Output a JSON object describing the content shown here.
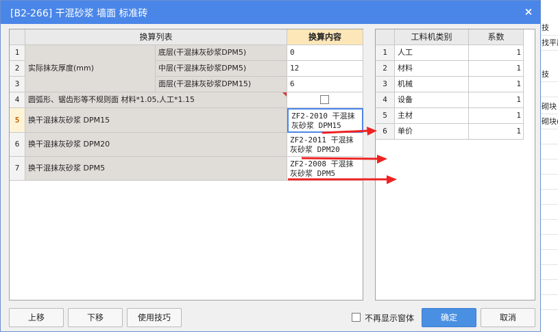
{
  "background": {
    "rows": [
      "技",
      "找平层",
      "技",
      "",
      "砌块",
      "砌块(",
      "",
      "",
      "",
      "",
      "",
      "",
      "",
      "",
      "",
      "",
      "",
      "",
      "",
      "",
      ""
    ]
  },
  "dialog": {
    "title": "[B2-266] 干混砂浆 墙面 标准砖",
    "close_icon": "×"
  },
  "left_table": {
    "header_list": "换算列表",
    "header_content": "换算内容",
    "group_label": "实际抹灰厚度(mm)",
    "rows": [
      {
        "num": "1",
        "label": "底层(干混抹灰砂浆DPM5)",
        "value": "0"
      },
      {
        "num": "2",
        "label": "中层(干混抹灰砂浆DPM5)",
        "value": "12"
      },
      {
        "num": "3",
        "label": "面层(干混抹灰砂浆DPM15)",
        "value": "6"
      },
      {
        "num": "4",
        "label": "圆弧形、锯齿形等不规则面 材料*1.05,人工*1.15",
        "value": ""
      },
      {
        "num": "5",
        "label": "换干混抹灰砂浆 DPM15",
        "value_line1": "ZF2-2010  干混抹",
        "value_line2": "灰砂浆 DPM15"
      },
      {
        "num": "6",
        "label": "换干混抹灰砂浆 DPM20",
        "value_line1": "ZF2-2011  干混抹",
        "value_line2": "灰砂浆 DPM20"
      },
      {
        "num": "7",
        "label": "换干混抹灰砂浆 DPM5",
        "value_line1": "ZF2-2008  干混抹",
        "value_line2": "灰砂浆 DPM5"
      }
    ]
  },
  "right_table": {
    "header_category": "工料机类别",
    "header_coef": "系数",
    "rows": [
      {
        "num": "1",
        "category": "人工",
        "coef": "1"
      },
      {
        "num": "2",
        "category": "材料",
        "coef": "1"
      },
      {
        "num": "3",
        "category": "机械",
        "coef": "1"
      },
      {
        "num": "4",
        "category": "设备",
        "coef": "1"
      },
      {
        "num": "5",
        "category": "主材",
        "coef": "1"
      },
      {
        "num": "6",
        "category": "单价",
        "coef": "1"
      }
    ]
  },
  "footer": {
    "move_up": "上移",
    "move_down": "下移",
    "tips": "使用技巧",
    "dont_show": "不再显示窗体",
    "ok": "确定",
    "cancel": "取消"
  },
  "colors": {
    "titlebar": "#4a86e8",
    "primary": "#4a90e2",
    "arrow": "#ee2222"
  }
}
